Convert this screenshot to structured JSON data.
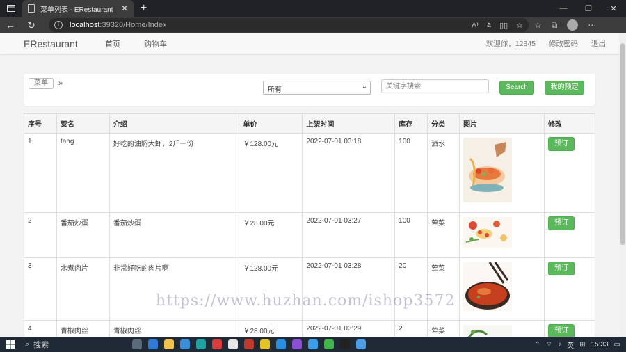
{
  "browser": {
    "tab_title": "菜单列表 - ERestaurant",
    "url_host": "localhost",
    "url_path": ":39320/Home/Index",
    "read_aloud": "A⁾",
    "translate": "á"
  },
  "navbar": {
    "brand": "ERestaurant",
    "links": [
      "首页",
      "购物车"
    ],
    "welcome": "欢迎你，12345",
    "change_password": "修改密码",
    "logout": "退出"
  },
  "toolbar": {
    "breadcrumb": "菜单",
    "breadcrumb_sep": "»",
    "category_selected": "所有",
    "search_placeholder": "关键字搜索",
    "search_label": "Search",
    "reserve_label": "我的预定"
  },
  "table": {
    "headers": [
      "序号",
      "菜名",
      "介绍",
      "单价",
      "上架时间",
      "库存",
      "分类",
      "图片",
      "修改"
    ],
    "rows": [
      {
        "id": "1",
        "name": "tang",
        "desc": "好吃的油焖大虾，2斤一份",
        "price": "￥128.00元",
        "time": "2022-07-01 03:18",
        "stock": "100",
        "category": "酒水",
        "action": "预订"
      },
      {
        "id": "2",
        "name": "番茄炒蛋",
        "desc": "番茄炒蛋",
        "price": "￥28.00元",
        "time": "2022-07-01 03:27",
        "stock": "100",
        "category": "荤菜",
        "action": "预订"
      },
      {
        "id": "3",
        "name": "水煮肉片",
        "desc": "非常好吃的肉片啊",
        "price": "￥128.00元",
        "time": "2022-07-01 03:28",
        "stock": "20",
        "category": "荤菜",
        "action": "预订"
      },
      {
        "id": "4",
        "name": "青椒肉丝",
        "desc": "青椒肉丝",
        "price": "￥28.00元",
        "time": "2022-07-01 03:29",
        "stock": "2",
        "category": "荤菜",
        "action": "预订"
      }
    ]
  },
  "watermark": "https://www.huzhan.com/ishop3572",
  "taskbar": {
    "search_label": "搜索",
    "ime": "英",
    "time": "15:33"
  },
  "colors": {
    "accent_green": "#5cb85c",
    "browser_dark": "#202124"
  }
}
